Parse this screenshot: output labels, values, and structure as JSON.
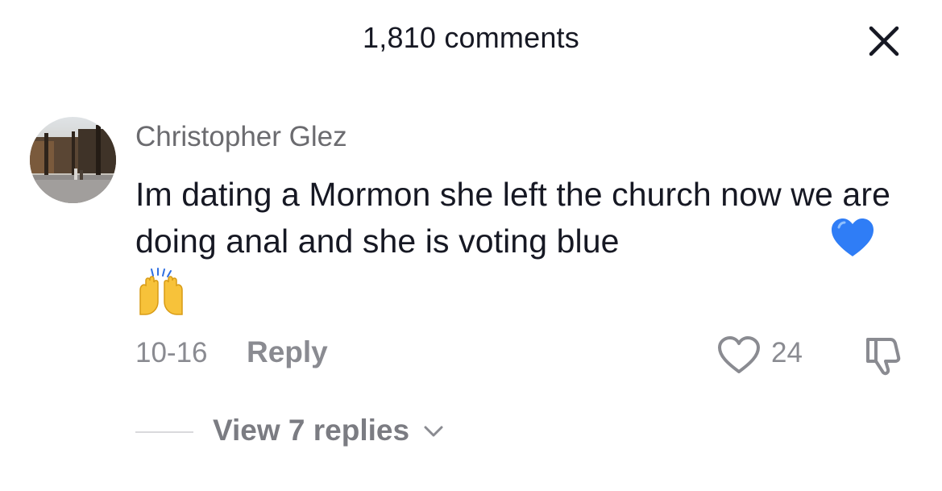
{
  "header": {
    "title": "1,810 comments"
  },
  "icons": {
    "close": "close-icon",
    "like": "heart-outline-icon",
    "dislike": "thumbs-down-icon",
    "expand": "chevron-down-icon"
  },
  "comment": {
    "username": "Christopher Glez",
    "text": "Im dating a Mormon she left the church now we are doing anal and she is voting blue",
    "emojis": [
      "blue-heart-emoji",
      "raising-hands-emoji"
    ],
    "date": "10-16",
    "reply_label": "Reply",
    "like_count": "24",
    "view_replies_label": "View 7 replies"
  },
  "colors": {
    "text_primary": "#161823",
    "text_secondary": "#8a8b91",
    "heart_blue": "#2f7df6",
    "hands_yellow": "#f7c23a"
  }
}
